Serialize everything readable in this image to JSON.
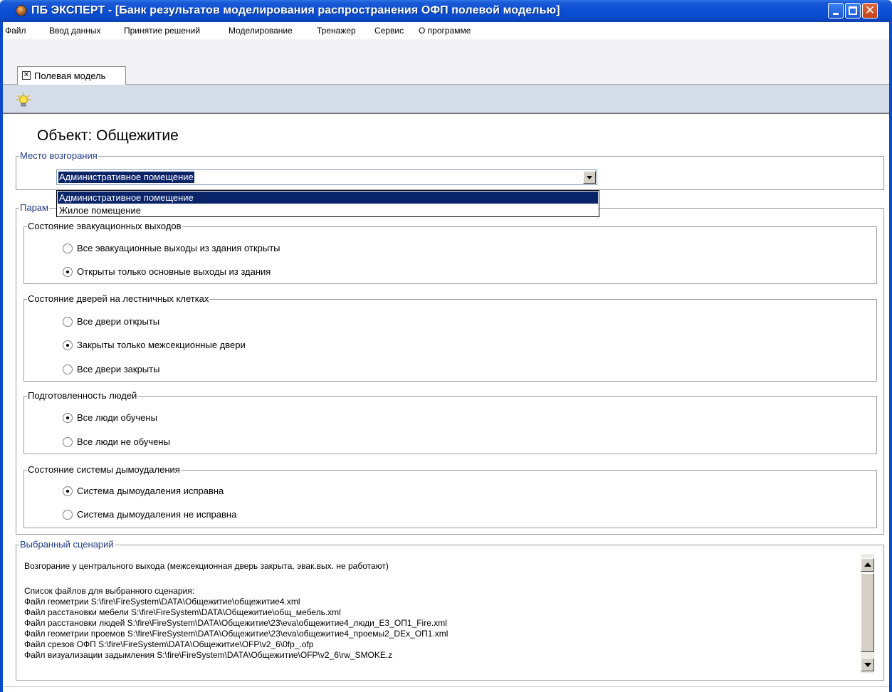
{
  "window": {
    "title": "ПБ ЭКСПЕРТ - [Банк результатов моделирования распространения ОФП полевой моделью]"
  },
  "menu": [
    "Файл",
    "Ввод данных",
    "Принятие решений",
    "Моделирование",
    "Тренажер",
    "Сервис",
    "О программе"
  ],
  "tabs": [
    {
      "label": "Полевая модель"
    }
  ],
  "toolbar": {
    "icon": "lightbulb-icon"
  },
  "object": {
    "title": "Объект: Общежитие"
  },
  "fire_location": {
    "caption": "Место возгорания",
    "selected": "Административное помещение",
    "options": [
      "Административное помещение",
      "Жилое помещение"
    ]
  },
  "parameters": {
    "caption_visible": "Парам",
    "groups": [
      {
        "caption": "Состояние эвакуационных выходов",
        "options": [
          {
            "label": "Все эвакуационные выходы из здания открыты",
            "checked": false
          },
          {
            "label": "Открыты только основные выходы из здания",
            "checked": true
          }
        ]
      },
      {
        "caption": "Состояние дверей на лестничных клетках",
        "options": [
          {
            "label": "Все двери открыты",
            "checked": false
          },
          {
            "label": "Закрыты только межсекционные двери",
            "checked": true
          },
          {
            "label": "Все двери закрыты",
            "checked": false
          }
        ]
      },
      {
        "caption": "Подготовленность людей",
        "options": [
          {
            "label": "Все люди обучены",
            "checked": true
          },
          {
            "label": "Все люди не обучены",
            "checked": false
          }
        ]
      },
      {
        "caption": "Состояние системы дымоудаления",
        "options": [
          {
            "label": "Система дымоудаления исправна",
            "checked": true
          },
          {
            "label": "Система дымоудаления не исправна",
            "checked": false
          }
        ]
      }
    ]
  },
  "scenario": {
    "caption": "Выбранный сценарий",
    "lines": [
      "Возгорание у центрального выхода (межсекционная дверь закрыта, эвак.вых. не работают)",
      "Список файлов для выбранного сценария:",
      "Файл геометрии S:\\fire\\FireSystem\\DATA\\Общежитие\\общежитие4.xml",
      "Файл расстановки мебели S:\\fire\\FireSystem\\DATA\\Общежитие\\общ_мебель.xml",
      "Файл расстановки людей S:\\fire\\FireSystem\\DATA\\Общежитие\\23\\eva\\общежитие4_люди_Е3_ОП1_Fire.xml",
      "Файл геометрии проемов S:\\fire\\FireSystem\\DATA\\Общежитие\\23\\eva\\общежитие4_проемы2_DEx_ОП1.xml",
      "Файл срезов ОФП S:\\fire\\FireSystem\\DATA\\Общежитие\\OFP\\v2_6\\0fp_.ofp",
      "Файл визуализации задымления S:\\fire\\FireSystem\\DATA\\Общежитие\\OFP\\v2_6\\rw_SMOKE.z"
    ]
  }
}
